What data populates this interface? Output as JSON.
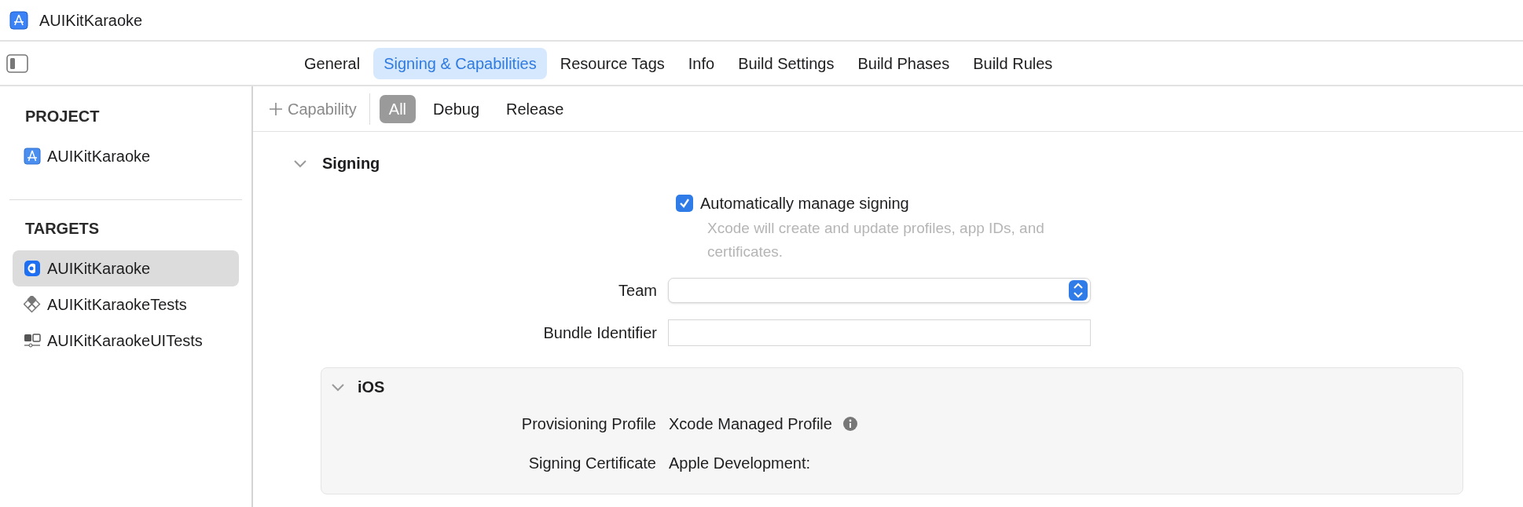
{
  "window": {
    "title": "AUIKitKaraoke"
  },
  "tabs": [
    {
      "label": "General",
      "selected": false
    },
    {
      "label": "Signing & Capabilities",
      "selected": true
    },
    {
      "label": "Resource Tags",
      "selected": false
    },
    {
      "label": "Info",
      "selected": false
    },
    {
      "label": "Build Settings",
      "selected": false
    },
    {
      "label": "Build Phases",
      "selected": false
    },
    {
      "label": "Build Rules",
      "selected": false
    }
  ],
  "sidebar": {
    "sections": [
      {
        "heading": "PROJECT",
        "items": [
          {
            "label": "AUIKitKaraoke",
            "kind": "project",
            "selected": false
          }
        ]
      },
      {
        "heading": "TARGETS",
        "items": [
          {
            "label": "AUIKitKaraoke",
            "kind": "app",
            "selected": true
          },
          {
            "label": "AUIKitKaraokeTests",
            "kind": "tests",
            "selected": false
          },
          {
            "label": "AUIKitKaraokeUITests",
            "kind": "uitests",
            "selected": false
          }
        ]
      }
    ]
  },
  "filter_bar": {
    "add_label": "Capability",
    "scopes": [
      {
        "label": "All",
        "selected": true
      },
      {
        "label": "Debug",
        "selected": false
      },
      {
        "label": "Release",
        "selected": false
      }
    ]
  },
  "signing": {
    "title": "Signing",
    "expanded": true,
    "auto_manage": {
      "label": "Automatically manage signing",
      "checked": true,
      "description": "Xcode will create and update profiles, app IDs, and certificates."
    },
    "fields": [
      {
        "label": "Team",
        "kind": "popup"
      },
      {
        "label": "Bundle Identifier",
        "kind": "text"
      }
    ],
    "ios": {
      "title": "iOS",
      "expanded": true,
      "rows": [
        {
          "label": "Provisioning Profile",
          "value": "Xcode Managed Profile",
          "info": true
        },
        {
          "label": "Signing Certificate",
          "value": "Apple Development:",
          "info": false
        }
      ]
    }
  }
}
